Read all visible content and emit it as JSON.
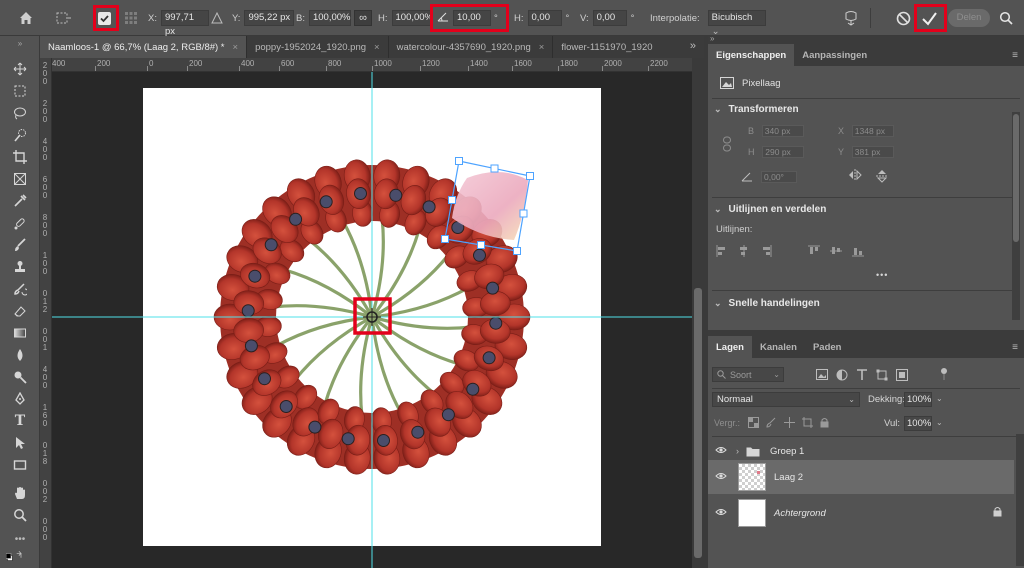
{
  "options_bar": {
    "x_label": "X:",
    "x_value": "997,71 px",
    "y_label": "Y:",
    "y_value": "995,22 px",
    "b_label": "B:",
    "b_value": "100,00%",
    "h_label": "H:",
    "h_value": "100,00%",
    "angle_value": "10,00",
    "angle_unit": "°",
    "hskew_label": "H:",
    "hskew_value": "0,00",
    "hskew_unit": "°",
    "vskew_label": "V:",
    "vskew_value": "0,00",
    "vskew_unit": "°",
    "interp_label": "Interpolatie:",
    "interp_value": "Bicubisch",
    "share_label": "Delen",
    "highlight_color": "#e3001b"
  },
  "tabs": [
    {
      "label": "Naamloos-1 @ 66,7% (Laag 2, RGB/8#) *",
      "close": "×"
    },
    {
      "label": "poppy-1952024_1920.png",
      "close": "×"
    },
    {
      "label": "watercolour-4357690_1920.png",
      "close": "×"
    },
    {
      "label": "flower-1151970_1920",
      "close": ""
    }
  ],
  "tab_overflow": "»",
  "rulers": {
    "top": [
      "400",
      "200",
      "0",
      "200",
      "400",
      "600",
      "800",
      "1000",
      "1200",
      "1400",
      "1600",
      "1800",
      "2000",
      "2200"
    ],
    "left": [
      "2",
      "0",
      "0",
      "2",
      "0",
      "0",
      "4",
      "0",
      "0",
      "6",
      "0",
      "0",
      "8",
      "0",
      "0",
      "1",
      "0",
      "0",
      "0",
      "1",
      "2",
      "0",
      "0",
      "1",
      "4",
      "0",
      "0",
      "1",
      "6",
      "0",
      "0",
      "1",
      "8",
      "0",
      "0",
      "2",
      "0",
      "0",
      "0"
    ]
  },
  "properties": {
    "tabs": [
      "Eigenschappen",
      "Aanpassingen"
    ],
    "layer_type": "Pixellaag",
    "transform_title": "Transformeren",
    "b_label": "B",
    "b_value": "340 px",
    "x_label": "X",
    "x_value": "1348 px",
    "h_label": "H",
    "h_value": "290 px",
    "y_label": "Y",
    "y_value": "381 px",
    "angle_value": "0,00°",
    "align_title": "Uitlijnen en verdelen",
    "align_sub": "Uitlijnen:",
    "more": "•••",
    "quick_title": "Snelle handelingen"
  },
  "layers": {
    "tabs": [
      "Lagen",
      "Kanalen",
      "Paden"
    ],
    "filter_placeholder": "Soort",
    "blend_mode": "Normaal",
    "opacity_label": "Dekking:",
    "opacity_value": "100%",
    "lock_label": "Vergr.:",
    "fill_label": "Vul:",
    "fill_value": "100%",
    "items": [
      {
        "name": "Groep 1"
      },
      {
        "name": "Laag 2"
      },
      {
        "name": "Achtergrond"
      }
    ]
  },
  "colors": {
    "guide": "#4fe0e8",
    "selection": "#4da3ff",
    "poppy_red": "#b8372b"
  }
}
